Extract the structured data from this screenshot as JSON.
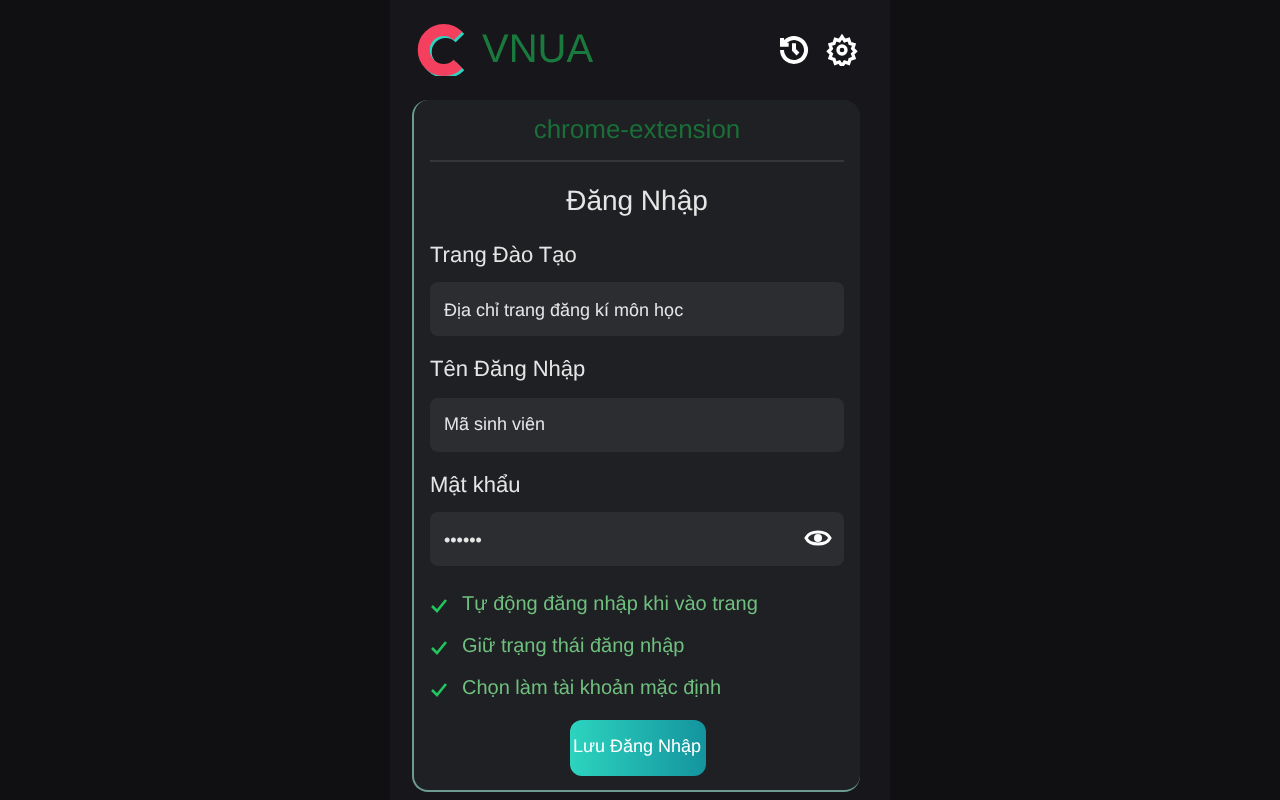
{
  "header": {
    "brand": "VNUA"
  },
  "card": {
    "subtitle": "chrome-extension",
    "title": "Đăng Nhập",
    "fields": [
      {
        "label": "Trang Đào Tạo",
        "placeholder": "Địa chỉ trang đăng kí môn học",
        "kind": "text"
      },
      {
        "label": "Tên Đăng Nhập",
        "placeholder": "Mã sinh viên",
        "kind": "text"
      },
      {
        "label": "Mật khẩu",
        "value": "••••••",
        "kind": "password"
      }
    ],
    "options": [
      {
        "label": "Tự động đăng nhập khi vào trang",
        "checked": true
      },
      {
        "label": "Giữ trạng thái đăng nhập",
        "checked": true
      },
      {
        "label": "Chọn làm tài khoản mặc định",
        "checked": true
      }
    ],
    "button": "Lưu Đăng Nhập"
  }
}
